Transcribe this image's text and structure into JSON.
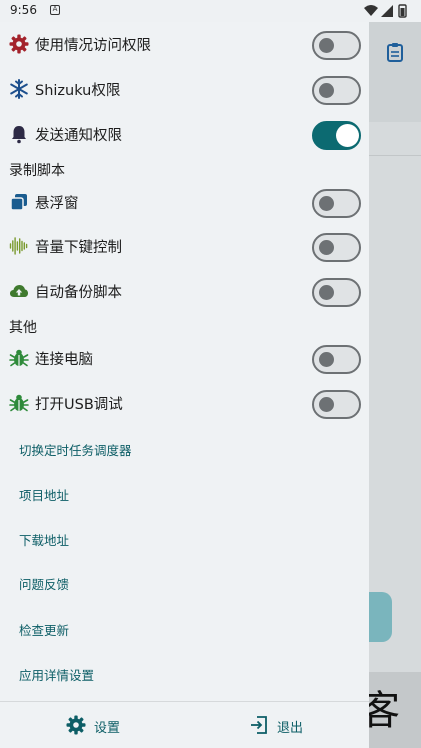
{
  "status_bar": {
    "time": "9:56",
    "notification_badge": "A"
  },
  "drawer": {
    "permission_rows": [
      {
        "label": "使用情况访问权限",
        "icon": "gear-icon",
        "enabled": false
      },
      {
        "label": "Shizuku权限",
        "icon": "snowflake-icon",
        "enabled": false
      },
      {
        "label": "发送通知权限",
        "icon": "bell-icon",
        "enabled": true
      }
    ],
    "section_record": "录制脚本",
    "record_rows": [
      {
        "label": "悬浮窗",
        "icon": "floating-window-icon",
        "enabled": false
      },
      {
        "label": "音量下键控制",
        "icon": "sound-wave-icon",
        "enabled": false
      },
      {
        "label": "自动备份脚本",
        "icon": "cloud-upload-icon",
        "enabled": false
      }
    ],
    "section_other": "其他",
    "other_rows": [
      {
        "label": "连接电脑",
        "icon": "bug-icon",
        "enabled": false
      },
      {
        "label": "打开USB调试",
        "icon": "bug-icon",
        "enabled": false
      }
    ],
    "links": [
      "切换定时任务调度器",
      "项目地址",
      "下载地址",
      "问题反馈",
      "检查更新",
      "应用详情设置"
    ],
    "bottom": {
      "settings_label": "设置",
      "exit_label": "退出"
    }
  },
  "background": {
    "watermark": "大玩客"
  },
  "colors": {
    "accent": "#0c6a71",
    "link": "#0d5e66",
    "drawer_bg": "#eff2f4"
  }
}
